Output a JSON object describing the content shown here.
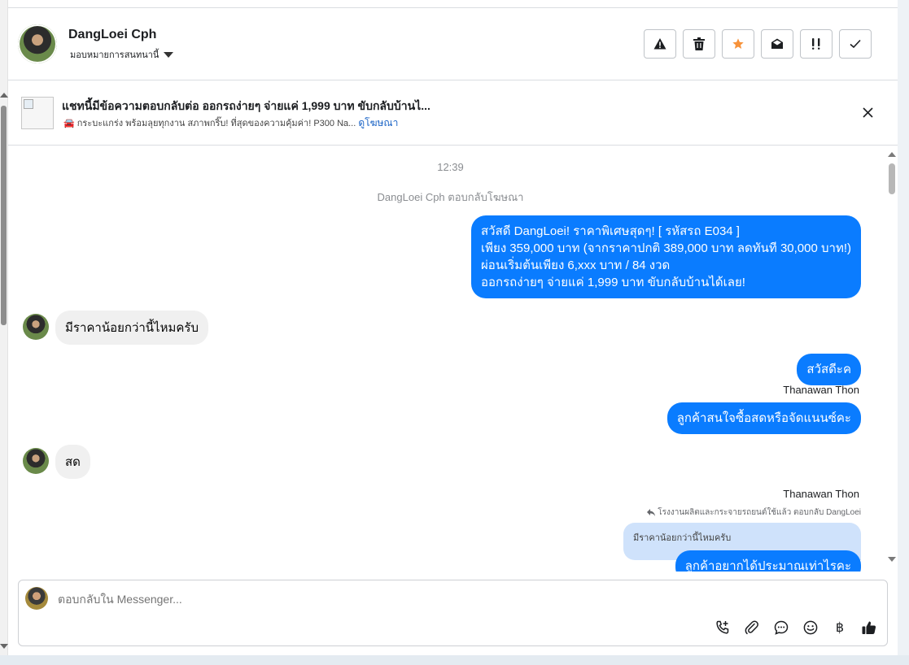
{
  "contact": {
    "name": "DangLoei Cph",
    "assign_label": "มอบหมายการสนทนานี้"
  },
  "actions": [
    {
      "icon": "warning-icon"
    },
    {
      "icon": "trash-icon"
    },
    {
      "icon": "star-icon",
      "color": "#f7923a"
    },
    {
      "icon": "mail-open-icon"
    },
    {
      "icon": "follow-up-icon"
    },
    {
      "icon": "check-icon"
    }
  ],
  "ad": {
    "title": "แชทนี้มีข้อความตอบกลับต่อ ออกรถง่ายๆ จ่ายแค่ 1,999 บาท ขับกลับบ้านไ...",
    "subtitle": "🚘 กระบะแกร่ง พร้อมลุยทุกงาน สภาพกริ๊บ! ที่สุดของความคุ้มค่า! P300 Na...",
    "link": "ดูโฆษณา"
  },
  "conversation": {
    "time": "12:39",
    "system": "DangLoei Cph ตอบกลับโฆษณา",
    "greeting_lines": [
      "สวัสดี DangLoei! ราคาพิเศษสุดๆ! [ รหัสรถ E034 ]",
      "เพียง 359,000 บาท (จากราคาปกติ 389,000 บาท ลดทันที 30,000 บาท!)",
      "ผ่อนเริ่มต้นเพียง 6,xxx บาท / 84 งวด",
      "ออกรถง่ายๆ จ่ายแค่ 1,999 บาท ขับกลับบ้านได้เลย!"
    ],
    "in1": "มีราคาน้อยกว่านี้ไหมครับ",
    "out1": "สวัสดีะค",
    "sender1": "Thanawan Thon",
    "out2": "ลูกค้าสนใจซื้อสดหรือจัดแนนซ์คะ",
    "in2": "สด",
    "sender2": "Thanawan Thon",
    "reply_meta": "โรงงานผลิตและกระจายรถยนต์ใช้แล้ว ตอบกลับ DangLoei",
    "quoted": "มีราคาน้อยกว่านี้ไหมครับ",
    "out3": "ลูกค้าอยากได้ประมาณเท่าไรคะ"
  },
  "composer": {
    "placeholder": "ตอบกลับใน Messenger...",
    "tools": [
      "call-add-icon",
      "attach-icon",
      "chat-bubble-icon",
      "emoji-icon",
      "baht-icon",
      "thumbs-up-icon"
    ],
    "baht_symbol": "฿"
  }
}
